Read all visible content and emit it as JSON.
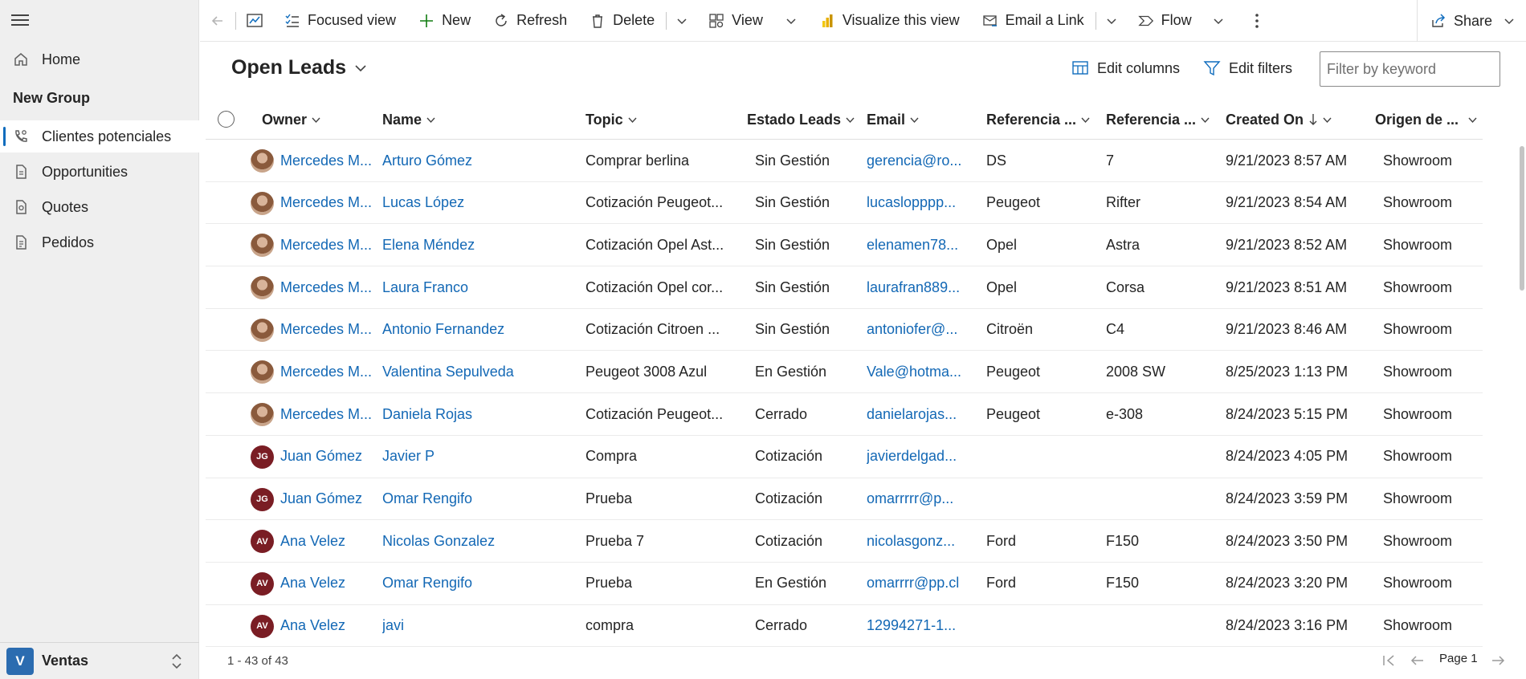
{
  "sidebar": {
    "items_top": [
      {
        "label": "Home",
        "icon": "home-icon"
      }
    ],
    "group_title": "New Group",
    "items": [
      {
        "label": "Clientes potenciales",
        "icon": "phone-person-icon",
        "active": true
      },
      {
        "label": "Opportunities",
        "icon": "document-icon"
      },
      {
        "label": "Quotes",
        "icon": "quote-icon"
      },
      {
        "label": "Pedidos",
        "icon": "list-document-icon"
      }
    ],
    "area": {
      "badge": "V",
      "label": "Ventas"
    }
  },
  "toolbar": {
    "focused_view": "Focused view",
    "new": "New",
    "refresh": "Refresh",
    "delete": "Delete",
    "view": "View",
    "visualize": "Visualize this view",
    "email_link": "Email a Link",
    "flow": "Flow",
    "share": "Share"
  },
  "view": {
    "title": "Open Leads",
    "edit_columns": "Edit columns",
    "edit_filters": "Edit filters",
    "filter_placeholder": "Filter by keyword"
  },
  "grid": {
    "columns": [
      "Owner",
      "Name",
      "Topic",
      "Estado Leads",
      "Email",
      "Referencia ...",
      "Referencia ...",
      "Created On",
      "Origen de ..."
    ],
    "rows": [
      {
        "avatar": "photo",
        "initials": "",
        "owner": "Mercedes M...",
        "name": "Arturo Gómez",
        "topic": "Comprar berlina",
        "estado": "Sin Gestión",
        "email": "gerencia@ro...",
        "ref1": "DS",
        "ref2": "7",
        "created": "9/21/2023 8:57 AM",
        "origen": "Showroom"
      },
      {
        "avatar": "photo",
        "initials": "",
        "owner": "Mercedes M...",
        "name": "Lucas López",
        "topic": "Cotización Peugeot...",
        "estado": "Sin Gestión",
        "email": "lucaslopppp...",
        "ref1": "Peugeot",
        "ref2": "Rifter",
        "created": "9/21/2023 8:54 AM",
        "origen": "Showroom"
      },
      {
        "avatar": "photo",
        "initials": "",
        "owner": "Mercedes M...",
        "name": "Elena Méndez",
        "topic": "Cotización Opel Ast...",
        "estado": "Sin Gestión",
        "email": "elenamen78...",
        "ref1": "Opel",
        "ref2": "Astra",
        "created": "9/21/2023 8:52 AM",
        "origen": "Showroom"
      },
      {
        "avatar": "photo",
        "initials": "",
        "owner": "Mercedes M...",
        "name": "Laura Franco",
        "topic": "Cotización Opel cor...",
        "estado": "Sin Gestión",
        "email": "laurafran889...",
        "ref1": "Opel",
        "ref2": "Corsa",
        "created": "9/21/2023 8:51 AM",
        "origen": "Showroom"
      },
      {
        "avatar": "photo",
        "initials": "",
        "owner": "Mercedes M...",
        "name": "Antonio Fernandez",
        "topic": "Cotización Citroen ...",
        "estado": "Sin Gestión",
        "email": "antoniofer@...",
        "ref1": "Citroën",
        "ref2": "C4",
        "created": "9/21/2023 8:46 AM",
        "origen": "Showroom"
      },
      {
        "avatar": "photo",
        "initials": "",
        "owner": "Mercedes M...",
        "name": "Valentina Sepulveda",
        "topic": "Peugeot 3008 Azul",
        "estado": "En Gestión",
        "email": "Vale@hotma...",
        "ref1": "Peugeot",
        "ref2": "2008 SW",
        "created": "8/25/2023 1:13 PM",
        "origen": "Showroom"
      },
      {
        "avatar": "photo",
        "initials": "",
        "owner": "Mercedes M...",
        "name": "Daniela Rojas",
        "topic": "Cotización Peugeot...",
        "estado": "Cerrado",
        "email": "danielarojas...",
        "ref1": "Peugeot",
        "ref2": "e-308",
        "created": "8/24/2023 5:15 PM",
        "origen": "Showroom"
      },
      {
        "avatar": "initials",
        "initials": "JG",
        "owner": "Juan Gómez",
        "name": "Javier P",
        "topic": "Compra",
        "estado": "Cotización",
        "email": "javierdelgad...",
        "ref1": "",
        "ref2": "",
        "created": "8/24/2023 4:05 PM",
        "origen": "Showroom"
      },
      {
        "avatar": "initials",
        "initials": "JG",
        "owner": "Juan Gómez",
        "name": "Omar Rengifo",
        "topic": "Prueba",
        "estado": "Cotización",
        "email": "omarrrrr@p...",
        "ref1": "",
        "ref2": "",
        "created": "8/24/2023 3:59 PM",
        "origen": "Showroom"
      },
      {
        "avatar": "initials",
        "initials": "AV",
        "owner": "Ana Velez",
        "name": "Nicolas Gonzalez",
        "topic": "Prueba 7",
        "estado": "Cotización",
        "email": "nicolasgonz...",
        "ref1": "Ford",
        "ref2": "F150",
        "created": "8/24/2023 3:50 PM",
        "origen": "Showroom"
      },
      {
        "avatar": "initials",
        "initials": "AV",
        "owner": "Ana Velez",
        "name": "Omar Rengifo",
        "topic": "Prueba",
        "estado": "En Gestión",
        "email": "omarrrr@pp.cl",
        "ref1": "Ford",
        "ref2": "F150",
        "created": "8/24/2023 3:20 PM",
        "origen": "Showroom"
      },
      {
        "avatar": "initials",
        "initials": "AV",
        "owner": "Ana Velez",
        "name": "javi",
        "topic": "compra",
        "estado": "Cerrado",
        "email": "12994271-1...",
        "ref1": "",
        "ref2": "",
        "created": "8/24/2023 3:16 PM",
        "origen": "Showroom"
      }
    ]
  },
  "footer": {
    "count": "1 - 43 of 43",
    "page": "Page 1"
  },
  "colors": {
    "link": "#1368b5",
    "accent": "#0f6cbd",
    "initials_avatar": "#7a1d24",
    "area_badge": "#2b6cb0"
  }
}
